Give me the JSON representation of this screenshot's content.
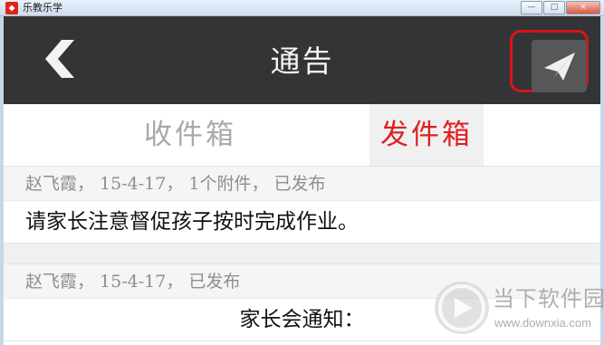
{
  "window": {
    "title": "乐教乐学",
    "controls": {
      "minimize": "—",
      "maximize": "□",
      "close": "×"
    }
  },
  "header": {
    "back_icon": "chevron-left-icon",
    "title": "通告",
    "send_icon": "paper-plane-icon"
  },
  "tabs": [
    {
      "label": "收件箱",
      "active": false
    },
    {
      "label": "发件箱",
      "active": true
    }
  ],
  "messages": [
    {
      "meta": "赵飞霞， 15-4-17， 1个附件， 已发布",
      "body": "请家长注意督促孩子按时完成作业。"
    },
    {
      "meta": "赵飞霞， 15-4-17， 已发布",
      "body": "家长会通知："
    }
  ],
  "watermark": {
    "name": "当下软件园",
    "url": "www.downxia.com"
  },
  "colors": {
    "header_bg": "#333435",
    "active_tab": "#e01f22",
    "highlight_box": "#d9141b"
  }
}
